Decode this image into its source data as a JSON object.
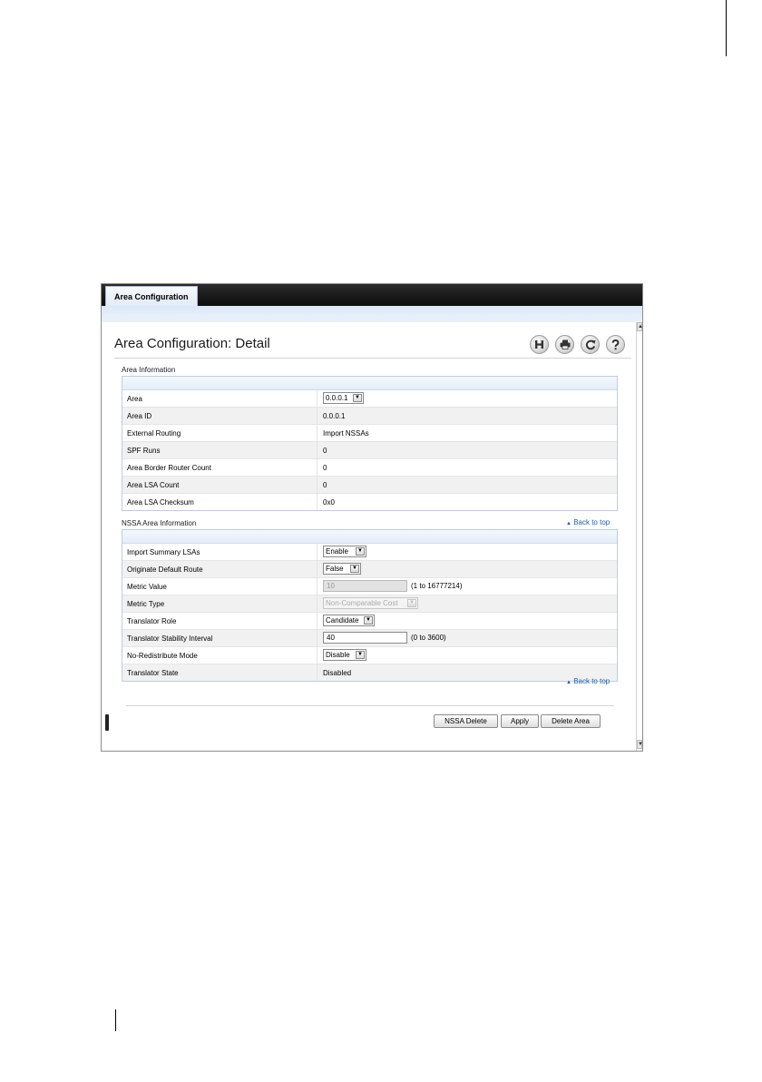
{
  "tab": {
    "label": "Area Configuration"
  },
  "title": "Area Configuration: Detail",
  "toolbar": {
    "icons": [
      "save-icon",
      "print-icon",
      "refresh-icon",
      "help-icon"
    ]
  },
  "area_info": {
    "section_label": "Area Information",
    "rows": {
      "area": {
        "label": "Area",
        "value": "0.0.0.1"
      },
      "area_id": {
        "label": "Area ID",
        "value": "0.0.0.1"
      },
      "external_routing": {
        "label": "External Routing",
        "value": "Import NSSAs"
      },
      "spf_runs": {
        "label": "SPF Runs",
        "value": "0"
      },
      "abr_count": {
        "label": "Area Border Router Count",
        "value": "0"
      },
      "lsa_count": {
        "label": "Area LSA Count",
        "value": "0"
      },
      "lsa_checksum": {
        "label": "Area LSA Checksum",
        "value": "0x0"
      }
    }
  },
  "back_to_top": "Back to top",
  "nssa_info": {
    "section_label": "NSSA Area Information",
    "rows": {
      "import_summary": {
        "label": "Import Summary LSAs",
        "value": "Enable"
      },
      "originate_default": {
        "label": "Originate Default Route",
        "value": "False"
      },
      "metric_value": {
        "label": "Metric Value",
        "value": "10",
        "hint": "(1 to 16777214)"
      },
      "metric_type": {
        "label": "Metric Type",
        "value": "Non-Comparable Cost"
      },
      "translator_role": {
        "label": "Translator Role",
        "value": "Candidate"
      },
      "stability_interval": {
        "label": "Translator Stability Interval",
        "value": "40",
        "hint": "(0 to 3600)"
      },
      "no_redistribute": {
        "label": "No-Redistribute Mode",
        "value": "Disable"
      },
      "translator_state": {
        "label": "Translator State",
        "value": "Disabled"
      }
    }
  },
  "buttons": {
    "nssa_delete": "NSSA Delete",
    "apply": "Apply",
    "delete_area": "Delete Area"
  }
}
